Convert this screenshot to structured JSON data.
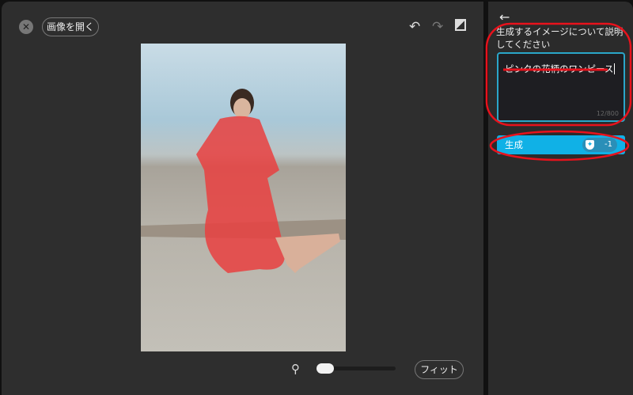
{
  "toolbar": {
    "close_icon": "close-icon",
    "open_image_label": "画像を開く",
    "undo_icon": "undo-icon",
    "redo_icon": "redo-icon",
    "compare_icon": "compare-icon"
  },
  "bottom": {
    "zoom_icon": "search-icon",
    "zoom_level_percent": 5,
    "fit_label": "フィット"
  },
  "panel": {
    "back_icon": "arrow-left-icon",
    "prompt_label": "生成するイメージについて説明してください",
    "prompt_value": "ピンクの花柄のワンピース",
    "char_count": "12/800",
    "generate_label": "生成",
    "credit_cost": "-1",
    "accent": "#10b1e6"
  }
}
